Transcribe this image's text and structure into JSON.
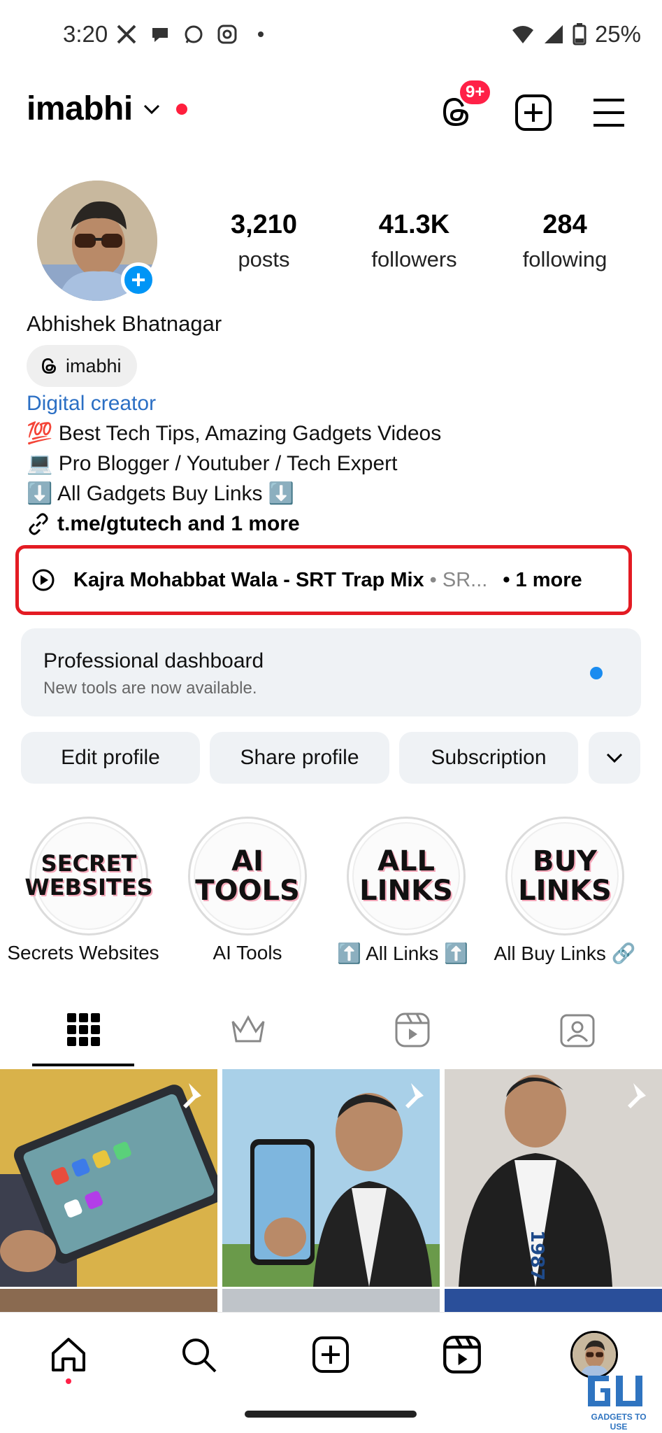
{
  "status_bar": {
    "time": "3:20",
    "battery": "25%"
  },
  "header": {
    "username": "imabhi",
    "notification_badge": "9+"
  },
  "profile": {
    "stats": [
      {
        "value": "3,210",
        "label": "posts"
      },
      {
        "value": "41.3K",
        "label": "followers"
      },
      {
        "value": "284",
        "label": "following"
      }
    ],
    "full_name": "Abhishek Bhatnagar",
    "threads_handle": "imabhi",
    "category": "Digital creator",
    "bio_lines": [
      "💯 Best Tech Tips, Amazing Gadgets Videos",
      "💻 Pro Blogger / Youtuber / Tech Expert",
      "⬇️ All Gadgets Buy Links ⬇️"
    ],
    "link": "t.me/gtutech and 1 more"
  },
  "music": {
    "title": "Kajra Mohabbat Wala - SRT Trap Mix",
    "subtitle": "• SR...",
    "more": "• 1 more"
  },
  "dashboard": {
    "title": "Professional dashboard",
    "subtitle": "New tools are now available."
  },
  "buttons": {
    "edit": "Edit profile",
    "share": "Share profile",
    "subscription": "Subscription"
  },
  "highlights": [
    {
      "cover_line1": "SECRET",
      "cover_line2": "WEBSITES",
      "label": "Secrets Websites"
    },
    {
      "cover_line1": "AI",
      "cover_line2": "TOOLS",
      "label": "AI Tools"
    },
    {
      "cover_line1": "ALL",
      "cover_line2": "LINKS",
      "label": "⬆️ All Links ⬆️"
    },
    {
      "cover_line1": "BUY",
      "cover_line2": "LINKS",
      "label": "All Buy Links 🔗"
    }
  ],
  "watermark": {
    "text": "GADGETS TO USE"
  },
  "colors": {
    "accent": "#0095f6",
    "link_blue": "#2b6fc4",
    "highlight_red": "#e31b23",
    "badge_red": "#ff2147"
  }
}
